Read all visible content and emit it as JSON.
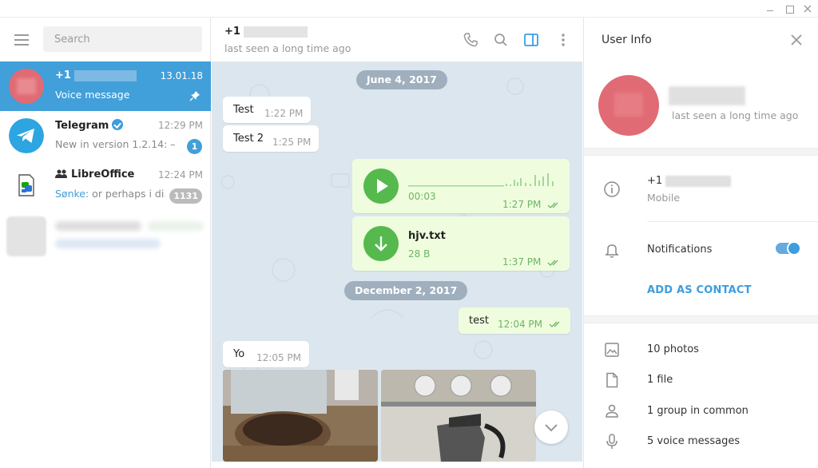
{
  "window": {
    "minimize": "minimize",
    "maximize": "maximize",
    "close": "close"
  },
  "sidebar": {
    "search_placeholder": "Search",
    "dialogs": [
      {
        "name": "+1",
        "time": "13.01.18",
        "preview": "Voice message",
        "pinned": true,
        "avatar_color": "#e06b74"
      },
      {
        "name": "Telegram",
        "time": "12:29 PM",
        "preview": "New in version 1.2.14: —...",
        "badge": "1",
        "verified": true
      },
      {
        "name": "LibreOffice",
        "time": "12:24 PM",
        "sender": "Sønke:",
        "preview": " or perhaps i di...",
        "badge": "1131",
        "group": true
      }
    ]
  },
  "chat": {
    "title": "+1",
    "status": "last seen a long time ago",
    "dates": [
      "June 4, 2017",
      "December 2, 2017"
    ],
    "messages": [
      {
        "text": "Test",
        "time": "1:22 PM"
      },
      {
        "text": "Test 2",
        "time": "1:25 PM"
      },
      {
        "voice_duration": "00:03",
        "time": "1:27 PM"
      },
      {
        "file_name": "hjv.txt",
        "file_size": "28 B",
        "time": "1:37 PM"
      },
      {
        "text": "test",
        "time": "12:04 PM"
      },
      {
        "text": "Yo",
        "time": "12:05 PM"
      }
    ],
    "accent": "#55b94d"
  },
  "info": {
    "title": "User Info",
    "status": "last seen a long time ago",
    "phone_prefix": "+1",
    "phone_label": "Mobile",
    "notifications": "Notifications",
    "notifications_on": true,
    "add_contact": "ADD AS CONTACT",
    "media": [
      "10 photos",
      "1 file",
      "1 group in common",
      "5 voice messages"
    ]
  },
  "colors": {
    "accent": "#419fd9",
    "outgoing": "#effdde",
    "chat_bg": "#dce6ee"
  }
}
